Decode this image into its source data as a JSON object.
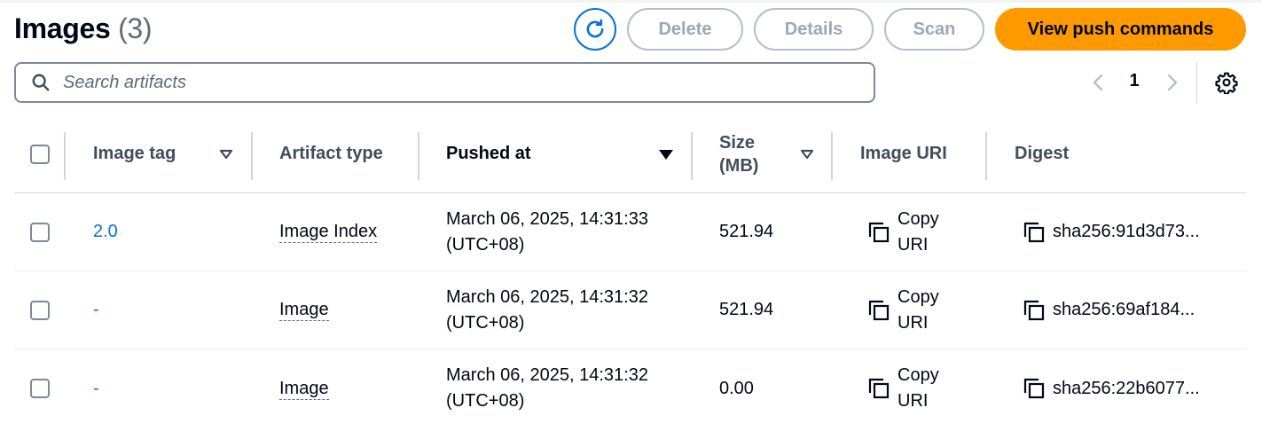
{
  "header": {
    "title": "Images",
    "count": "(3)",
    "buttons": {
      "refresh_icon": "refresh-icon",
      "delete": "Delete",
      "details": "Details",
      "scan": "Scan",
      "view_push_commands": "View push commands"
    }
  },
  "search": {
    "placeholder": "Search artifacts",
    "value": ""
  },
  "pagination": {
    "current_page": "1",
    "prev_icon": "chevron-left-icon",
    "next_icon": "chevron-right-icon",
    "settings_icon": "gear-icon"
  },
  "table": {
    "columns": [
      {
        "label": "Image tag",
        "sortable": true,
        "sort": "none"
      },
      {
        "label": "Artifact type",
        "sortable": false
      },
      {
        "label": "Pushed at",
        "sortable": true,
        "sort": "descending"
      },
      {
        "label": "Size\n(MB)",
        "sortable": true,
        "sort": "none"
      },
      {
        "label": "Image URI",
        "sortable": false
      },
      {
        "label": "Digest",
        "sortable": false
      }
    ],
    "rows": [
      {
        "tag": "2.0",
        "artifact_type": "Image Index",
        "pushed_at_line1": "March 06, 2025, 14:31:33",
        "pushed_at_line2": "(UTC+08)",
        "size": "521.94",
        "uri_line1": "Copy",
        "uri_line2": "URI",
        "digest": "sha256:91d3d73..."
      },
      {
        "tag": "-",
        "artifact_type": "Image",
        "pushed_at_line1": "March 06, 2025, 14:31:32",
        "pushed_at_line2": "(UTC+08)",
        "size": "521.94",
        "uri_line1": "Copy",
        "uri_line2": "URI",
        "digest": "sha256:69af184..."
      },
      {
        "tag": "-",
        "artifact_type": "Image",
        "pushed_at_line1": "March 06, 2025, 14:31:32",
        "pushed_at_line2": "(UTC+08)",
        "size": "0.00",
        "uri_line1": "Copy",
        "uri_line2": "URI",
        "digest": "sha256:22b6077..."
      }
    ]
  },
  "colors": {
    "primary_button": "#ff9900",
    "link": "#0972d3",
    "disabled": "#9ba7b6"
  }
}
